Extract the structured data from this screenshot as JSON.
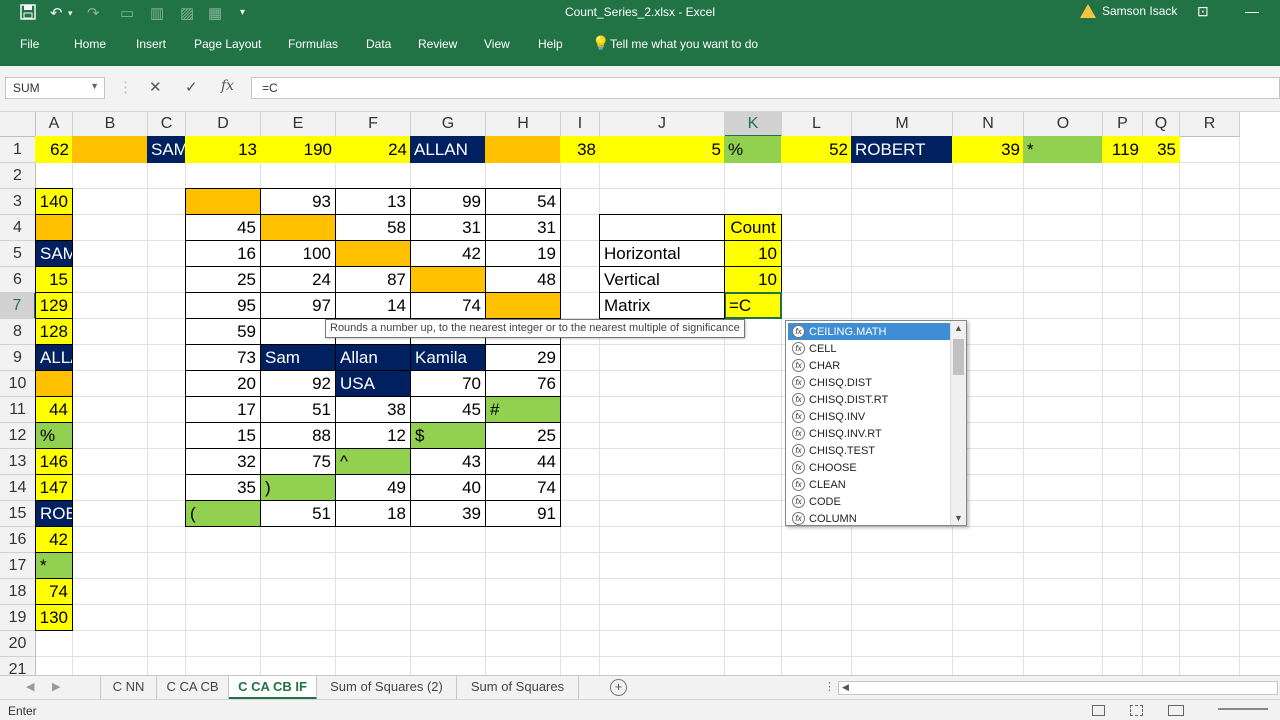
{
  "titlebar": {
    "file_title": "Count_Series_2.xlsx  -  Excel",
    "user_name": "Samson Isack",
    "save_icon": "save-icon",
    "undo_icon": "undo-icon",
    "redo_icon": "redo-icon"
  },
  "ribbon": {
    "tabs": [
      "File",
      "Home",
      "Insert",
      "Page Layout",
      "Formulas",
      "Data",
      "Review",
      "View",
      "Help"
    ],
    "tell_me": "Tell me what you want to do"
  },
  "formula_bar": {
    "name_box": "SUM",
    "cancel": "✕",
    "enter": "✓",
    "fx": "fx",
    "formula": "=C"
  },
  "columns": [
    "A",
    "B",
    "C",
    "D",
    "E",
    "F",
    "G",
    "H",
    "I",
    "J",
    "K",
    "L",
    "M",
    "N",
    "O",
    "P",
    "Q",
    "R"
  ],
  "rows": [
    "1",
    "2",
    "3",
    "4",
    "5",
    "6",
    "7",
    "8",
    "9",
    "10",
    "11",
    "12",
    "13",
    "14",
    "15",
    "16",
    "17",
    "18",
    "19",
    "20",
    "21"
  ],
  "cells": {
    "A1": "62",
    "C1": "SAM",
    "D1": "13",
    "E1": "190",
    "F1": "24",
    "G1": "ALLAN",
    "I1": "38",
    "J1": "5",
    "K1": "%",
    "L1": "52",
    "M1": "ROBERT",
    "N1": "39",
    "O1": "*",
    "P1": "119",
    "Q1": "35",
    "A3": "140",
    "A5": "SAM",
    "A6": "15",
    "A7": "129",
    "A8": "128",
    "A9": "ALLAN",
    "A11": "44",
    "A12": "%",
    "A13": "146",
    "A14": "147",
    "A15": "ROBERT",
    "A16": "42",
    "A17": "*",
    "A18": "74",
    "A19": "130",
    "E3": "93",
    "F3": "13",
    "G3": "99",
    "H3": "54",
    "D4": "45",
    "F4": "58",
    "G4": "31",
    "H4": "31",
    "D5": "16",
    "E5": "100",
    "G5": "42",
    "H5": "19",
    "D6": "25",
    "E6": "24",
    "F6": "87",
    "H6": "48",
    "D7": "95",
    "E7": "97",
    "F7": "14",
    "G7": "74",
    "D8": "59",
    "D9": "73",
    "E9": "Sam",
    "F9": "Allan",
    "G9": "Kamila",
    "H9": "29",
    "D10": "20",
    "E10": "92",
    "F10": "USA",
    "G10": "70",
    "H10": "76",
    "D11": "17",
    "E11": "51",
    "F11": "38",
    "G11": "45",
    "H11": "#",
    "D12": "15",
    "E12": "88",
    "F12": "12",
    "G12": "$",
    "H12": "25",
    "D13": "32",
    "E13": "75",
    "F13": "^",
    "G13": "43",
    "H13": "44",
    "D14": "35",
    "E14": ")",
    "F14": "49",
    "G14": "40",
    "H14": "74",
    "D15": "(",
    "E15": "51",
    "F15": "18",
    "G15": "39",
    "H15": "91",
    "K4": "Count",
    "J5": "Horizontal",
    "K5": "10",
    "J6": "Vertical",
    "K6": "10",
    "J7": "Matrix",
    "K7": "=C"
  },
  "tooltip": "Rounds a number up, to the nearest integer or to the nearest multiple of significance",
  "autocomplete": [
    "CEILING.MATH",
    "CELL",
    "CHAR",
    "CHISQ.DIST",
    "CHISQ.DIST.RT",
    "CHISQ.INV",
    "CHISQ.INV.RT",
    "CHISQ.TEST",
    "CHOOSE",
    "CLEAN",
    "CODE",
    "COLUMN"
  ],
  "sheet_tabs": [
    "C NN",
    "C CA CB",
    "C CA CB IF",
    "Sum of Squares (2)",
    "Sum of Squares"
  ],
  "active_sheet": "C CA CB IF",
  "status": "Enter",
  "colors": {
    "excel_green": "#217346",
    "yellow": "#ffff00",
    "orange": "#ffc000",
    "green": "#92d050",
    "navy": "#002060"
  }
}
